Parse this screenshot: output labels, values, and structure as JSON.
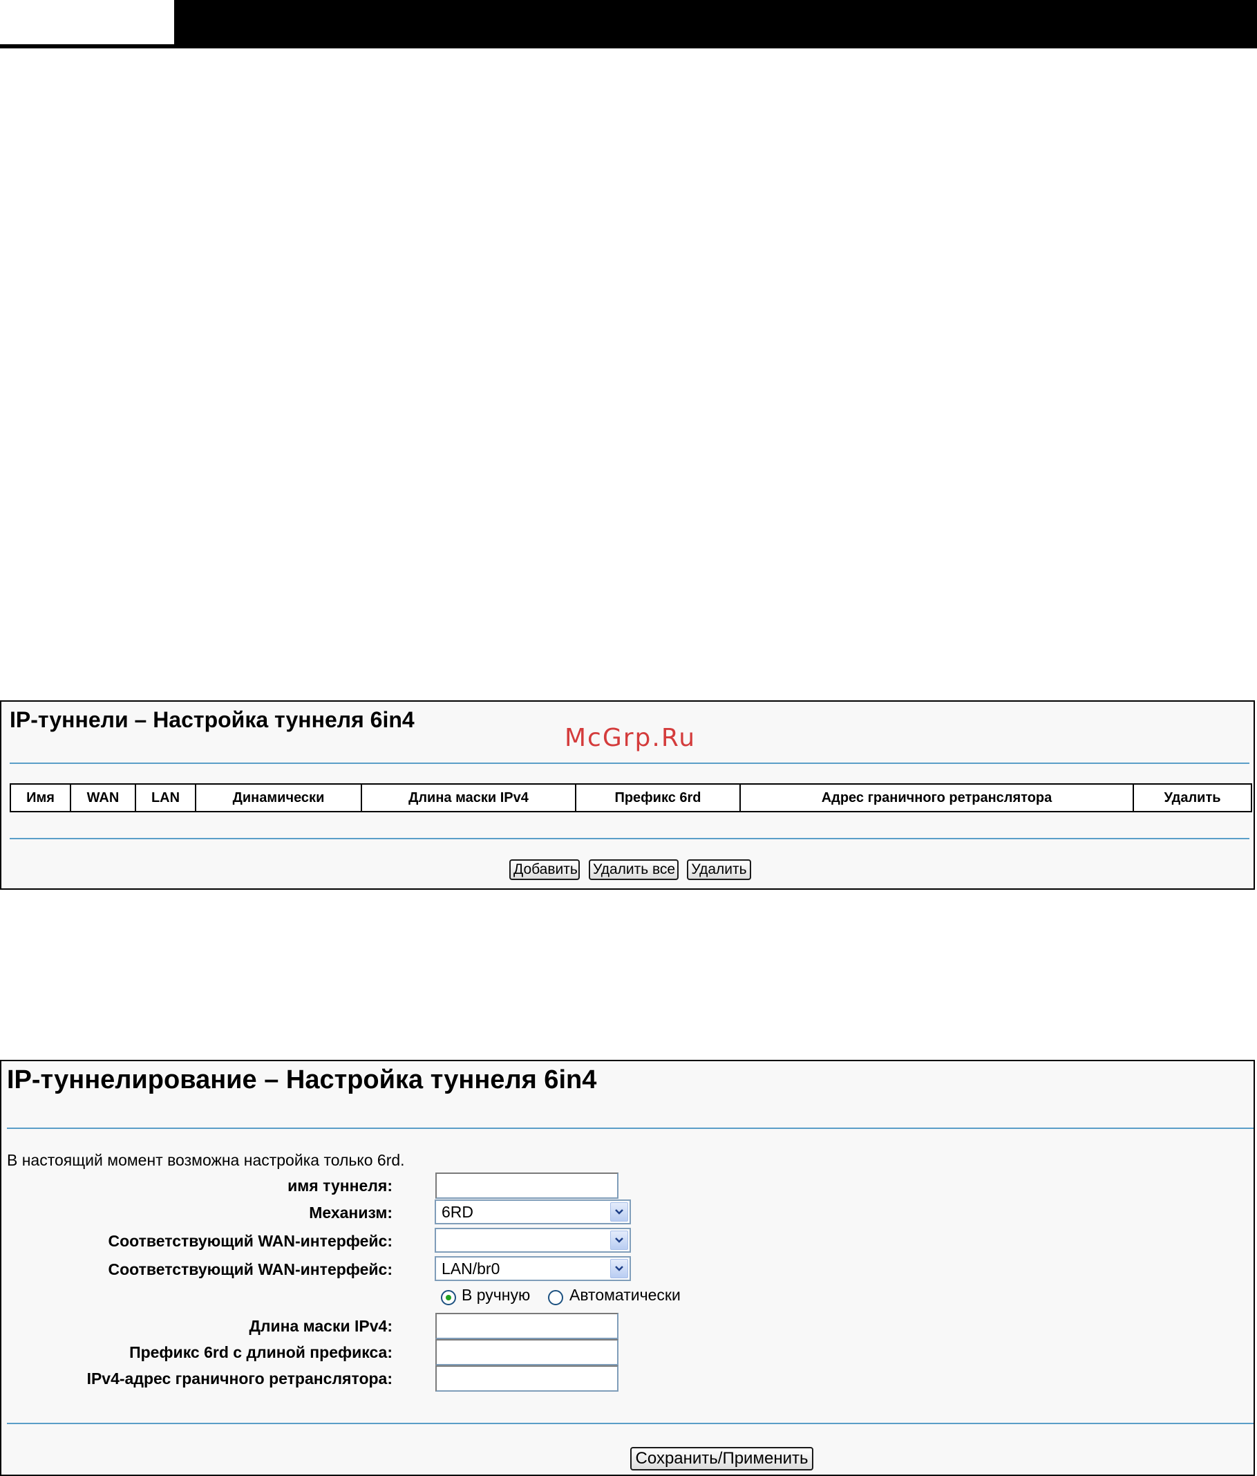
{
  "panel1": {
    "title": "IP-туннели – Настройка туннеля 6in4",
    "watermark": "McGrp.Ru",
    "columns": [
      "Имя",
      "WAN",
      "LAN",
      "Динамически",
      "Длина маски IPv4",
      "Префикс 6rd",
      "Адрес граничного ретранслятора",
      "Удалить"
    ],
    "buttons": {
      "add": "Добавить",
      "delete_all": "Удалить все",
      "delete": "Удалить"
    }
  },
  "panel2": {
    "title": "IP-туннелирование – Настройка туннеля 6in4",
    "note": "В настоящий момент возможна настройка только 6rd.",
    "fields": {
      "tunnel_name": {
        "label": "имя туннеля:",
        "value": ""
      },
      "mechanism": {
        "label": "Механизм:",
        "value": "6RD"
      },
      "wan_interface": {
        "label": "Соответствующий WAN-интерфейс:",
        "value": ""
      },
      "lan_interface": {
        "label": "Соответствующий WAN-интерфейс:",
        "value": "LAN/br0"
      },
      "mode": {
        "manual": "В ручную",
        "auto": "Автоматически",
        "selected": "manual"
      },
      "ipv4_mask_len": {
        "label": "Длина маски IPv4:",
        "value": ""
      },
      "prefix_6rd": {
        "label": "Префикс 6rd с длиной префикса:",
        "value": ""
      },
      "border_relay": {
        "label": "IPv4-адрес граничного ретранслятора:",
        "value": ""
      }
    },
    "buttons": {
      "save": "Сохранить/Применить"
    }
  }
}
